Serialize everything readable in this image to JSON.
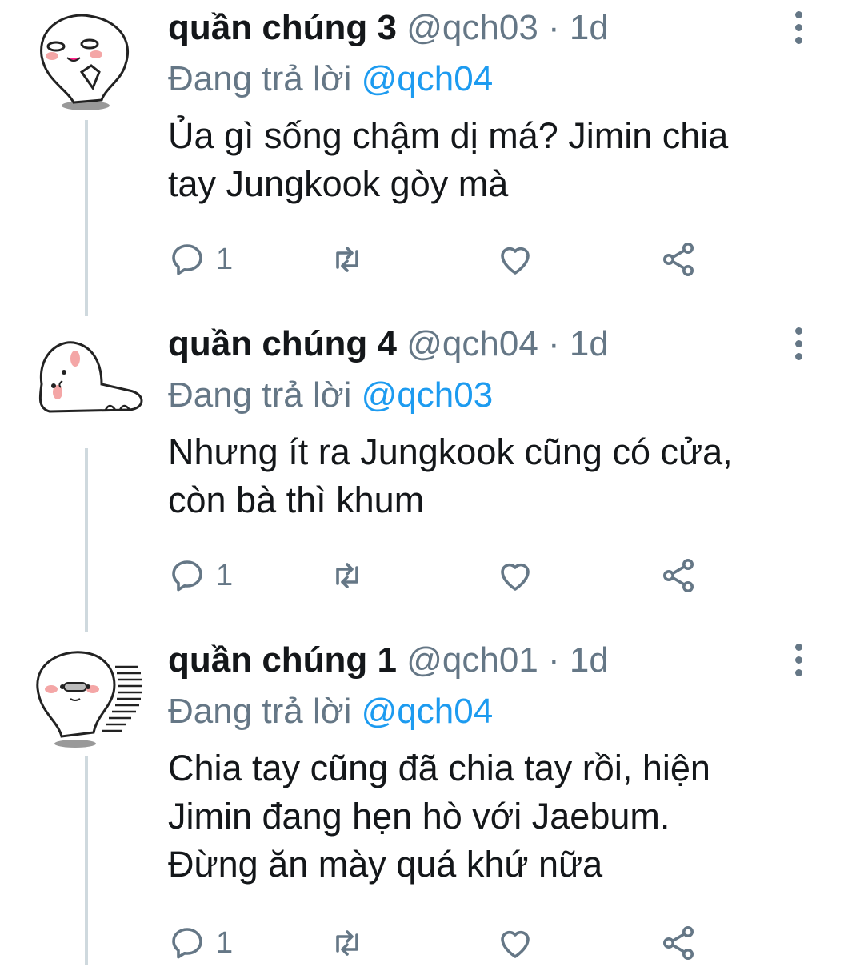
{
  "tweets": [
    {
      "name": "quần chúng 3",
      "handle": "@qch03",
      "separator": "·",
      "time": "1d",
      "replying_prefix": "Đang trả lời",
      "replying_to": "@qch04",
      "text": "Ủa gì sống chậm dị má? Jimin chia\ntay Jungkook gòy mà",
      "reply_count": "1"
    },
    {
      "name": "quần chúng 4",
      "handle": "@qch04",
      "separator": "·",
      "time": "1d",
      "replying_prefix": "Đang trả lời",
      "replying_to": "@qch03",
      "text": "Nhưng ít ra Jungkook cũng có cửa,\ncòn bà thì khum",
      "reply_count": "1"
    },
    {
      "name": "quần chúng 1",
      "handle": "@qch01",
      "separator": "·",
      "time": "1d",
      "replying_prefix": "Đang trả lời",
      "replying_to": "@qch04",
      "text": "Chia tay cũng đã chia tay rồi, hiện\nJimin đang hẹn hò với Jaebum.\nĐừng ăn mày quá khứ nữa",
      "reply_count": "1"
    }
  ],
  "icons": {
    "reply": "reply-icon",
    "retweet": "retweet-icon",
    "like": "heart-icon",
    "share": "share-icon",
    "more": "more-vertical-icon"
  },
  "colors": {
    "text": "#14171a",
    "secondary": "#657786",
    "mention": "#1d9bf0",
    "thread_line": "#cfd9de"
  }
}
